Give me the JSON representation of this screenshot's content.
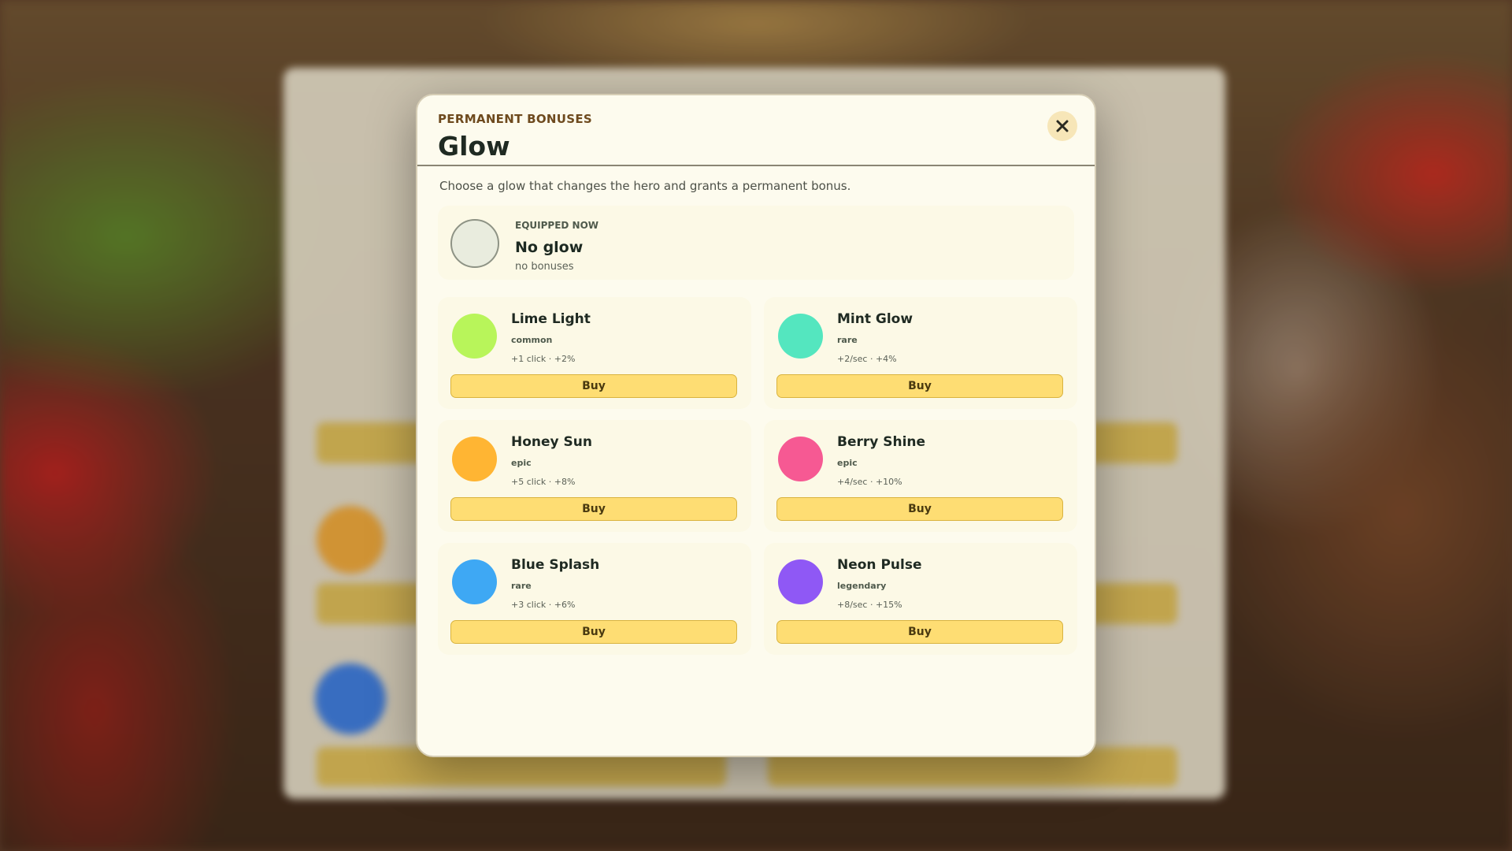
{
  "modal": {
    "eyebrow": "PERMANENT BONUSES",
    "title": "Glow",
    "subtitle": "Choose a glow that changes the hero and grants a permanent bonus.",
    "close_icon": "close-icon"
  },
  "equipped": {
    "label": "EQUIPPED NOW",
    "name": "No glow",
    "bonus": "no bonuses",
    "swatch_color": "#e9ecde"
  },
  "glows": [
    {
      "name": "Lime Light",
      "rarity": "common",
      "stats": "+1 click · +2%",
      "button": "Buy",
      "color": "#b8f55a"
    },
    {
      "name": "Mint Glow",
      "rarity": "rare",
      "stats": "+2/sec · +4%",
      "button": "Buy",
      "color": "#54e6bf"
    },
    {
      "name": "Honey Sun",
      "rarity": "epic",
      "stats": "+5 click · +8%",
      "button": "Buy",
      "color": "#ffb533"
    },
    {
      "name": "Berry Shine",
      "rarity": "epic",
      "stats": "+4/sec · +10%",
      "button": "Buy",
      "color": "#f65993"
    },
    {
      "name": "Blue Splash",
      "rarity": "rare",
      "stats": "+3 click · +6%",
      "button": "Buy",
      "color": "#3ea8f4"
    },
    {
      "name": "Neon Pulse",
      "rarity": "legendary",
      "stats": "+8/sec · +15%",
      "button": "Buy",
      "color": "#8f58f5"
    }
  ],
  "colors": {
    "accent_button": "#fedd73",
    "modal_background": "#fdfbee",
    "eyebrow_text": "#6e4a1e"
  }
}
